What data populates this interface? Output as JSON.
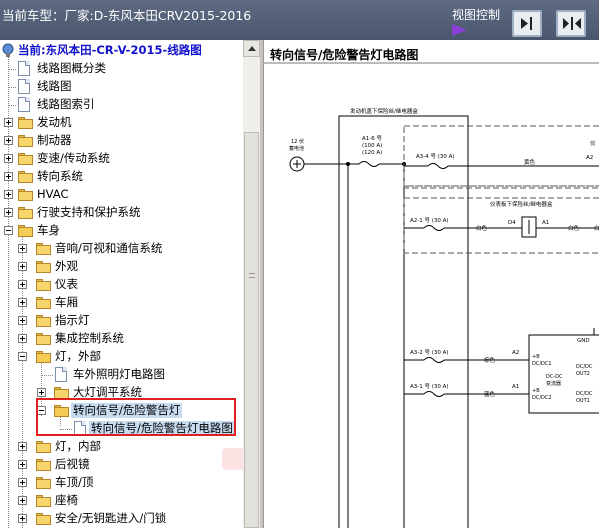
{
  "header": {
    "current_model": "当前车型：厂家:D-东风本田CRV2015-2016",
    "view_control_label": "视图控制"
  },
  "tree": {
    "root_label": "当前:东风本田-CR-V-2015-线路图",
    "items": [
      "线路图概分类",
      "线路图",
      "线路图索引",
      "发动机",
      "制动器",
      "变速/传动系统",
      "转向系统",
      "HVAC",
      "行驶支持和保护系统",
      "车身",
      "音响/可视和通信系统",
      "外观",
      "仪表",
      "车厢",
      "指示灯",
      "集成控制系统",
      "灯，外部",
      "车外照明灯电路图",
      "大灯调平系统",
      "转向信号/危险警告灯",
      "转向信号/危险警告灯电路图",
      "灯，内部",
      "后视镜",
      "车顶/顶",
      "座椅",
      "安全/无钥匙进入/门锁"
    ]
  },
  "diagram": {
    "title": "转向信号/危险警告灯电路图",
    "box_label": "发动机盖下保险丝/继电器盒",
    "ecu_box_label": "仪表板下保险丝/继电器盒",
    "battery_label": "12 伏\n蓄电池",
    "fuse_a1": "A1-6 号\n(100 A)\n(120 A)",
    "fuse_a3_4": "A3-4 号 (30 A)",
    "fuse_a2_1": "A2-1 号 (30 A)",
    "fuse_a3_2": "A3-2 号 (30 A)",
    "fuse_a3_1": "A3-1 号 (30 A)",
    "wire_yellow": "黄色",
    "wire_white": "白色",
    "wire_white2": "白色",
    "wire_white3": "白色",
    "wire_brown": "棕色",
    "wire_blue": "蓝色",
    "pin_a2": "A2",
    "pin_a2b": "A2",
    "pin_a1": "A1",
    "pin_a1b": "A1",
    "pin_d4": "D4",
    "gnd": "GND",
    "conv_in1": "+B\nDC/DC1",
    "conv_in2": "+B\nDC/DC2",
    "conv_mid": "DC-DC\n变流器",
    "conv_out1": "DC/DC\nOUT2",
    "conv_out2": "DC/DC\nOUT1",
    "cut_label": "仪"
  }
}
